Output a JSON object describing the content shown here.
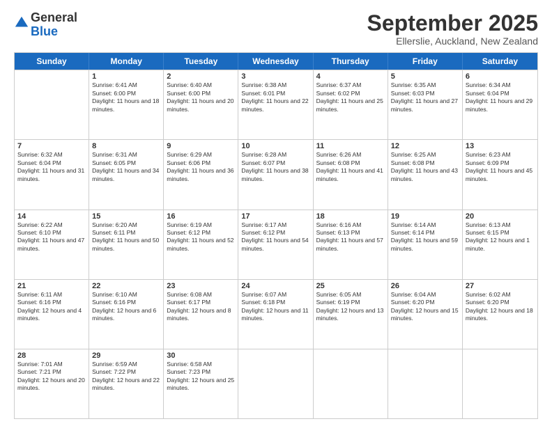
{
  "header": {
    "logo_general": "General",
    "logo_blue": "Blue",
    "title": "September 2025",
    "subtitle": "Ellerslie, Auckland, New Zealand"
  },
  "calendar": {
    "days": [
      "Sunday",
      "Monday",
      "Tuesday",
      "Wednesday",
      "Thursday",
      "Friday",
      "Saturday"
    ],
    "rows": [
      [
        {
          "day": "",
          "sunrise": "",
          "sunset": "",
          "daylight": ""
        },
        {
          "day": "1",
          "sunrise": "Sunrise: 6:41 AM",
          "sunset": "Sunset: 6:00 PM",
          "daylight": "Daylight: 11 hours and 18 minutes."
        },
        {
          "day": "2",
          "sunrise": "Sunrise: 6:40 AM",
          "sunset": "Sunset: 6:00 PM",
          "daylight": "Daylight: 11 hours and 20 minutes."
        },
        {
          "day": "3",
          "sunrise": "Sunrise: 6:38 AM",
          "sunset": "Sunset: 6:01 PM",
          "daylight": "Daylight: 11 hours and 22 minutes."
        },
        {
          "day": "4",
          "sunrise": "Sunrise: 6:37 AM",
          "sunset": "Sunset: 6:02 PM",
          "daylight": "Daylight: 11 hours and 25 minutes."
        },
        {
          "day": "5",
          "sunrise": "Sunrise: 6:35 AM",
          "sunset": "Sunset: 6:03 PM",
          "daylight": "Daylight: 11 hours and 27 minutes."
        },
        {
          "day": "6",
          "sunrise": "Sunrise: 6:34 AM",
          "sunset": "Sunset: 6:04 PM",
          "daylight": "Daylight: 11 hours and 29 minutes."
        }
      ],
      [
        {
          "day": "7",
          "sunrise": "Sunrise: 6:32 AM",
          "sunset": "Sunset: 6:04 PM",
          "daylight": "Daylight: 11 hours and 31 minutes."
        },
        {
          "day": "8",
          "sunrise": "Sunrise: 6:31 AM",
          "sunset": "Sunset: 6:05 PM",
          "daylight": "Daylight: 11 hours and 34 minutes."
        },
        {
          "day": "9",
          "sunrise": "Sunrise: 6:29 AM",
          "sunset": "Sunset: 6:06 PM",
          "daylight": "Daylight: 11 hours and 36 minutes."
        },
        {
          "day": "10",
          "sunrise": "Sunrise: 6:28 AM",
          "sunset": "Sunset: 6:07 PM",
          "daylight": "Daylight: 11 hours and 38 minutes."
        },
        {
          "day": "11",
          "sunrise": "Sunrise: 6:26 AM",
          "sunset": "Sunset: 6:08 PM",
          "daylight": "Daylight: 11 hours and 41 minutes."
        },
        {
          "day": "12",
          "sunrise": "Sunrise: 6:25 AM",
          "sunset": "Sunset: 6:08 PM",
          "daylight": "Daylight: 11 hours and 43 minutes."
        },
        {
          "day": "13",
          "sunrise": "Sunrise: 6:23 AM",
          "sunset": "Sunset: 6:09 PM",
          "daylight": "Daylight: 11 hours and 45 minutes."
        }
      ],
      [
        {
          "day": "14",
          "sunrise": "Sunrise: 6:22 AM",
          "sunset": "Sunset: 6:10 PM",
          "daylight": "Daylight: 11 hours and 47 minutes."
        },
        {
          "day": "15",
          "sunrise": "Sunrise: 6:20 AM",
          "sunset": "Sunset: 6:11 PM",
          "daylight": "Daylight: 11 hours and 50 minutes."
        },
        {
          "day": "16",
          "sunrise": "Sunrise: 6:19 AM",
          "sunset": "Sunset: 6:12 PM",
          "daylight": "Daylight: 11 hours and 52 minutes."
        },
        {
          "day": "17",
          "sunrise": "Sunrise: 6:17 AM",
          "sunset": "Sunset: 6:12 PM",
          "daylight": "Daylight: 11 hours and 54 minutes."
        },
        {
          "day": "18",
          "sunrise": "Sunrise: 6:16 AM",
          "sunset": "Sunset: 6:13 PM",
          "daylight": "Daylight: 11 hours and 57 minutes."
        },
        {
          "day": "19",
          "sunrise": "Sunrise: 6:14 AM",
          "sunset": "Sunset: 6:14 PM",
          "daylight": "Daylight: 11 hours and 59 minutes."
        },
        {
          "day": "20",
          "sunrise": "Sunrise: 6:13 AM",
          "sunset": "Sunset: 6:15 PM",
          "daylight": "Daylight: 12 hours and 1 minute."
        }
      ],
      [
        {
          "day": "21",
          "sunrise": "Sunrise: 6:11 AM",
          "sunset": "Sunset: 6:16 PM",
          "daylight": "Daylight: 12 hours and 4 minutes."
        },
        {
          "day": "22",
          "sunrise": "Sunrise: 6:10 AM",
          "sunset": "Sunset: 6:16 PM",
          "daylight": "Daylight: 12 hours and 6 minutes."
        },
        {
          "day": "23",
          "sunrise": "Sunrise: 6:08 AM",
          "sunset": "Sunset: 6:17 PM",
          "daylight": "Daylight: 12 hours and 8 minutes."
        },
        {
          "day": "24",
          "sunrise": "Sunrise: 6:07 AM",
          "sunset": "Sunset: 6:18 PM",
          "daylight": "Daylight: 12 hours and 11 minutes."
        },
        {
          "day": "25",
          "sunrise": "Sunrise: 6:05 AM",
          "sunset": "Sunset: 6:19 PM",
          "daylight": "Daylight: 12 hours and 13 minutes."
        },
        {
          "day": "26",
          "sunrise": "Sunrise: 6:04 AM",
          "sunset": "Sunset: 6:20 PM",
          "daylight": "Daylight: 12 hours and 15 minutes."
        },
        {
          "day": "27",
          "sunrise": "Sunrise: 6:02 AM",
          "sunset": "Sunset: 6:20 PM",
          "daylight": "Daylight: 12 hours and 18 minutes."
        }
      ],
      [
        {
          "day": "28",
          "sunrise": "Sunrise: 7:01 AM",
          "sunset": "Sunset: 7:21 PM",
          "daylight": "Daylight: 12 hours and 20 minutes."
        },
        {
          "day": "29",
          "sunrise": "Sunrise: 6:59 AM",
          "sunset": "Sunset: 7:22 PM",
          "daylight": "Daylight: 12 hours and 22 minutes."
        },
        {
          "day": "30",
          "sunrise": "Sunrise: 6:58 AM",
          "sunset": "Sunset: 7:23 PM",
          "daylight": "Daylight: 12 hours and 25 minutes."
        },
        {
          "day": "",
          "sunrise": "",
          "sunset": "",
          "daylight": ""
        },
        {
          "day": "",
          "sunrise": "",
          "sunset": "",
          "daylight": ""
        },
        {
          "day": "",
          "sunrise": "",
          "sunset": "",
          "daylight": ""
        },
        {
          "day": "",
          "sunrise": "",
          "sunset": "",
          "daylight": ""
        }
      ]
    ]
  }
}
